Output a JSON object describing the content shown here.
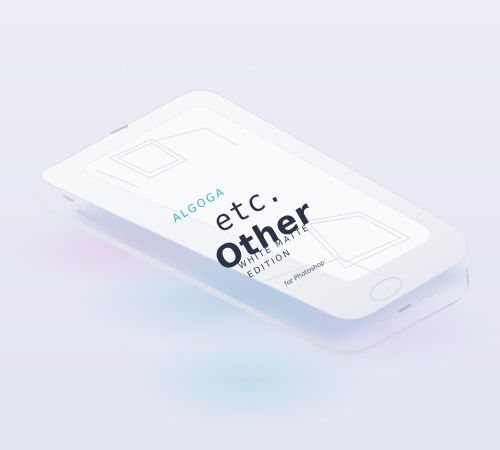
{
  "device": {
    "screen": {
      "brand": "ALGOGA",
      "title_line1": "etc.",
      "title_line2": "Other",
      "subtitle_line1": "WHITE MATTE",
      "subtitle_line2": "EDITION",
      "caption": "for Photoshop"
    },
    "colors": {
      "brand_accent": "#2fb8d3",
      "title_text": "#2d3345",
      "body": "#f3f4f8",
      "screen": "#fafafc"
    }
  }
}
